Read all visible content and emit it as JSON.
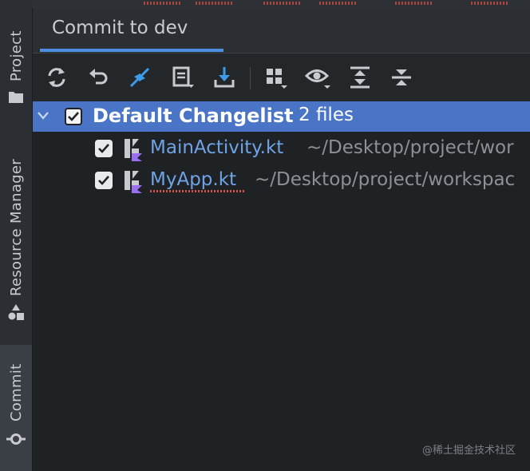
{
  "tool_strip": {
    "project": "Project",
    "resource_manager": "Resource Manager",
    "commit": "Commit"
  },
  "tab": {
    "label": "Commit to dev"
  },
  "toolbar": {
    "icons": [
      "refresh-icon",
      "rollback-icon",
      "show-diff-icon",
      "changelist-icon",
      "update-icon",
      "group-by-icon",
      "view-options-icon",
      "expand-all-icon",
      "collapse-all-icon"
    ]
  },
  "changelist": {
    "name": "Default Changelist",
    "count": "2 files",
    "files": [
      {
        "name": "MainActivity.kt",
        "path": "~/Desktop/project/wor"
      },
      {
        "name": "MyApp.kt",
        "path": "~/Desktop/project/workspac"
      }
    ]
  },
  "watermark": "@稀土掘金技术社区",
  "colors": {
    "selection": "#4a75c6",
    "file_name": "#6fa3e6",
    "accent": "#4c8fe0",
    "background": "#1f2225"
  }
}
